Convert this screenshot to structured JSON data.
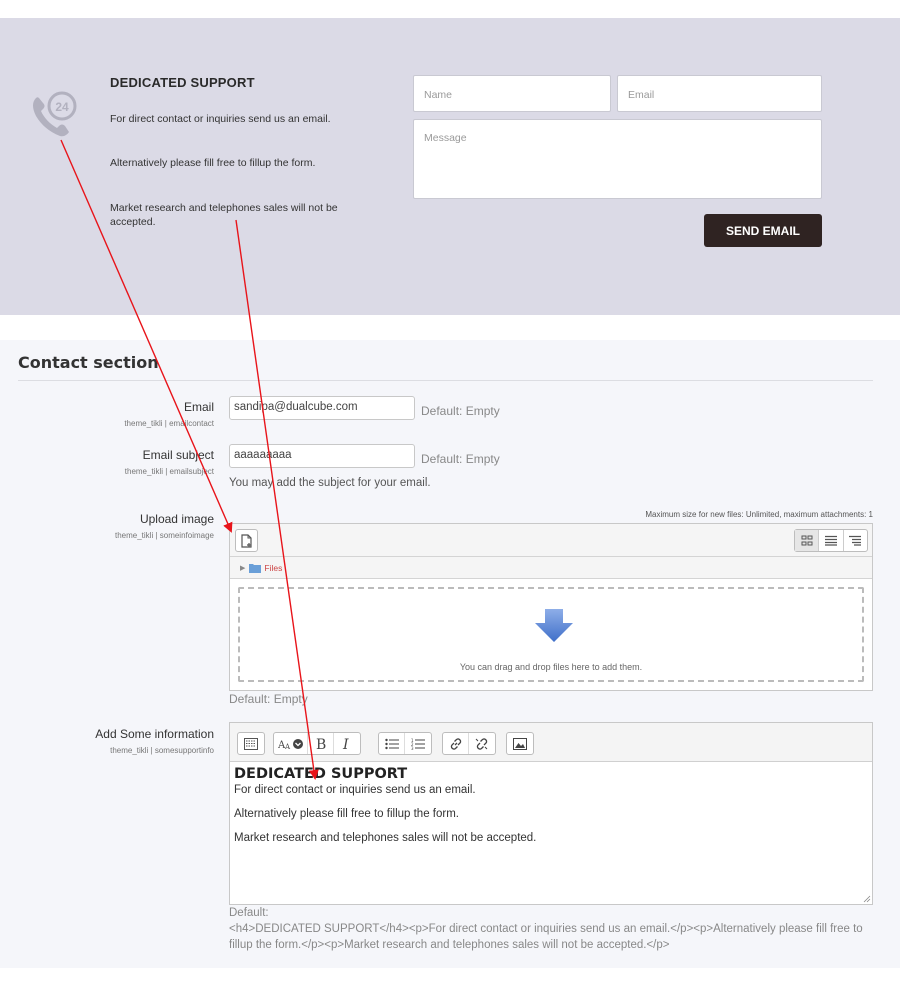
{
  "banner": {
    "title": "DEDICATED SUPPORT",
    "paragraphs": [
      "For direct contact or inquiries send us an email.",
      "Alternatively please fill free to fillup the form.",
      "Market research and telephones sales will not be accepted."
    ],
    "icon": "phone-24-icon",
    "name_placeholder": "Name",
    "email_placeholder": "Email",
    "message_placeholder": "Message",
    "send_label": "SEND EMAIL",
    "colors": {
      "background": "#dbdae6",
      "button": "#2f2322"
    }
  },
  "admin": {
    "section_title": "Contact section",
    "email": {
      "label": "Email",
      "setting": "theme_tikli | emailcontact",
      "value": "sandipa@dualcube.com",
      "default": "Default: Empty"
    },
    "email_subject": {
      "label": "Email subject",
      "setting": "theme_tikli | emailsubject",
      "value": "aaaaaaaaa",
      "default": "Default: Empty",
      "hint": "You may add the subject for your email."
    },
    "upload_image": {
      "label": "Upload image",
      "setting": "theme_tikli | someinfoimage",
      "max_size": "Maximum size for new files: Unlimited, maximum attachments: 1",
      "path_label": "Files",
      "drop_text": "You can drag and drop files here to add them.",
      "default": "Default: Empty"
    },
    "add_info": {
      "label": "Add Some information",
      "setting": "theme_tikli | somesupportinfo",
      "heading": "DEDICATED SUPPORT",
      "paragraphs": [
        "For direct contact or inquiries send us an email.",
        "Alternatively please fill free to fillup the form.",
        "Market research and telephones sales will not be accepted."
      ],
      "default_label": "Default:",
      "default_value": "<h4>DEDICATED SUPPORT</h4><p>For direct contact or inquiries send us an email.</p><p>Alternatively please fill free to fillup the form.</p><p>Market research and telephones sales will not be accepted.</p>"
    }
  },
  "arrow_color": "#e8141a"
}
